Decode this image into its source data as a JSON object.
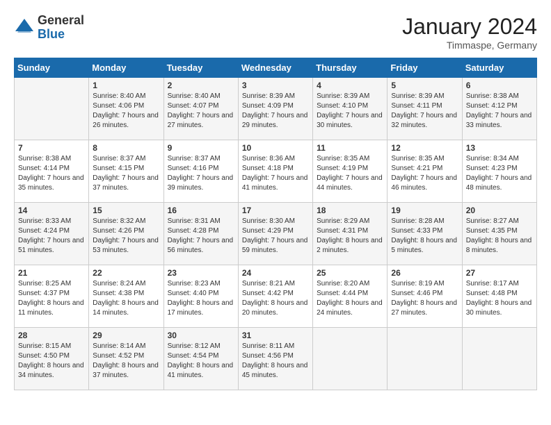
{
  "logo": {
    "general": "General",
    "blue": "Blue"
  },
  "title": "January 2024",
  "location": "Timmaspe, Germany",
  "days_of_week": [
    "Sunday",
    "Monday",
    "Tuesday",
    "Wednesday",
    "Thursday",
    "Friday",
    "Saturday"
  ],
  "weeks": [
    [
      {
        "day": "",
        "sunrise": "",
        "sunset": "",
        "daylight": ""
      },
      {
        "day": "1",
        "sunrise": "Sunrise: 8:40 AM",
        "sunset": "Sunset: 4:06 PM",
        "daylight": "Daylight: 7 hours and 26 minutes."
      },
      {
        "day": "2",
        "sunrise": "Sunrise: 8:40 AM",
        "sunset": "Sunset: 4:07 PM",
        "daylight": "Daylight: 7 hours and 27 minutes."
      },
      {
        "day": "3",
        "sunrise": "Sunrise: 8:39 AM",
        "sunset": "Sunset: 4:09 PM",
        "daylight": "Daylight: 7 hours and 29 minutes."
      },
      {
        "day": "4",
        "sunrise": "Sunrise: 8:39 AM",
        "sunset": "Sunset: 4:10 PM",
        "daylight": "Daylight: 7 hours and 30 minutes."
      },
      {
        "day": "5",
        "sunrise": "Sunrise: 8:39 AM",
        "sunset": "Sunset: 4:11 PM",
        "daylight": "Daylight: 7 hours and 32 minutes."
      },
      {
        "day": "6",
        "sunrise": "Sunrise: 8:38 AM",
        "sunset": "Sunset: 4:12 PM",
        "daylight": "Daylight: 7 hours and 33 minutes."
      }
    ],
    [
      {
        "day": "7",
        "sunrise": "Sunrise: 8:38 AM",
        "sunset": "Sunset: 4:14 PM",
        "daylight": "Daylight: 7 hours and 35 minutes."
      },
      {
        "day": "8",
        "sunrise": "Sunrise: 8:37 AM",
        "sunset": "Sunset: 4:15 PM",
        "daylight": "Daylight: 7 hours and 37 minutes."
      },
      {
        "day": "9",
        "sunrise": "Sunrise: 8:37 AM",
        "sunset": "Sunset: 4:16 PM",
        "daylight": "Daylight: 7 hours and 39 minutes."
      },
      {
        "day": "10",
        "sunrise": "Sunrise: 8:36 AM",
        "sunset": "Sunset: 4:18 PM",
        "daylight": "Daylight: 7 hours and 41 minutes."
      },
      {
        "day": "11",
        "sunrise": "Sunrise: 8:35 AM",
        "sunset": "Sunset: 4:19 PM",
        "daylight": "Daylight: 7 hours and 44 minutes."
      },
      {
        "day": "12",
        "sunrise": "Sunrise: 8:35 AM",
        "sunset": "Sunset: 4:21 PM",
        "daylight": "Daylight: 7 hours and 46 minutes."
      },
      {
        "day": "13",
        "sunrise": "Sunrise: 8:34 AM",
        "sunset": "Sunset: 4:23 PM",
        "daylight": "Daylight: 7 hours and 48 minutes."
      }
    ],
    [
      {
        "day": "14",
        "sunrise": "Sunrise: 8:33 AM",
        "sunset": "Sunset: 4:24 PM",
        "daylight": "Daylight: 7 hours and 51 minutes."
      },
      {
        "day": "15",
        "sunrise": "Sunrise: 8:32 AM",
        "sunset": "Sunset: 4:26 PM",
        "daylight": "Daylight: 7 hours and 53 minutes."
      },
      {
        "day": "16",
        "sunrise": "Sunrise: 8:31 AM",
        "sunset": "Sunset: 4:28 PM",
        "daylight": "Daylight: 7 hours and 56 minutes."
      },
      {
        "day": "17",
        "sunrise": "Sunrise: 8:30 AM",
        "sunset": "Sunset: 4:29 PM",
        "daylight": "Daylight: 7 hours and 59 minutes."
      },
      {
        "day": "18",
        "sunrise": "Sunrise: 8:29 AM",
        "sunset": "Sunset: 4:31 PM",
        "daylight": "Daylight: 8 hours and 2 minutes."
      },
      {
        "day": "19",
        "sunrise": "Sunrise: 8:28 AM",
        "sunset": "Sunset: 4:33 PM",
        "daylight": "Daylight: 8 hours and 5 minutes."
      },
      {
        "day": "20",
        "sunrise": "Sunrise: 8:27 AM",
        "sunset": "Sunset: 4:35 PM",
        "daylight": "Daylight: 8 hours and 8 minutes."
      }
    ],
    [
      {
        "day": "21",
        "sunrise": "Sunrise: 8:25 AM",
        "sunset": "Sunset: 4:37 PM",
        "daylight": "Daylight: 8 hours and 11 minutes."
      },
      {
        "day": "22",
        "sunrise": "Sunrise: 8:24 AM",
        "sunset": "Sunset: 4:38 PM",
        "daylight": "Daylight: 8 hours and 14 minutes."
      },
      {
        "day": "23",
        "sunrise": "Sunrise: 8:23 AM",
        "sunset": "Sunset: 4:40 PM",
        "daylight": "Daylight: 8 hours and 17 minutes."
      },
      {
        "day": "24",
        "sunrise": "Sunrise: 8:21 AM",
        "sunset": "Sunset: 4:42 PM",
        "daylight": "Daylight: 8 hours and 20 minutes."
      },
      {
        "day": "25",
        "sunrise": "Sunrise: 8:20 AM",
        "sunset": "Sunset: 4:44 PM",
        "daylight": "Daylight: 8 hours and 24 minutes."
      },
      {
        "day": "26",
        "sunrise": "Sunrise: 8:19 AM",
        "sunset": "Sunset: 4:46 PM",
        "daylight": "Daylight: 8 hours and 27 minutes."
      },
      {
        "day": "27",
        "sunrise": "Sunrise: 8:17 AM",
        "sunset": "Sunset: 4:48 PM",
        "daylight": "Daylight: 8 hours and 30 minutes."
      }
    ],
    [
      {
        "day": "28",
        "sunrise": "Sunrise: 8:15 AM",
        "sunset": "Sunset: 4:50 PM",
        "daylight": "Daylight: 8 hours and 34 minutes."
      },
      {
        "day": "29",
        "sunrise": "Sunrise: 8:14 AM",
        "sunset": "Sunset: 4:52 PM",
        "daylight": "Daylight: 8 hours and 37 minutes."
      },
      {
        "day": "30",
        "sunrise": "Sunrise: 8:12 AM",
        "sunset": "Sunset: 4:54 PM",
        "daylight": "Daylight: 8 hours and 41 minutes."
      },
      {
        "day": "31",
        "sunrise": "Sunrise: 8:11 AM",
        "sunset": "Sunset: 4:56 PM",
        "daylight": "Daylight: 8 hours and 45 minutes."
      },
      {
        "day": "",
        "sunrise": "",
        "sunset": "",
        "daylight": ""
      },
      {
        "day": "",
        "sunrise": "",
        "sunset": "",
        "daylight": ""
      },
      {
        "day": "",
        "sunrise": "",
        "sunset": "",
        "daylight": ""
      }
    ]
  ]
}
